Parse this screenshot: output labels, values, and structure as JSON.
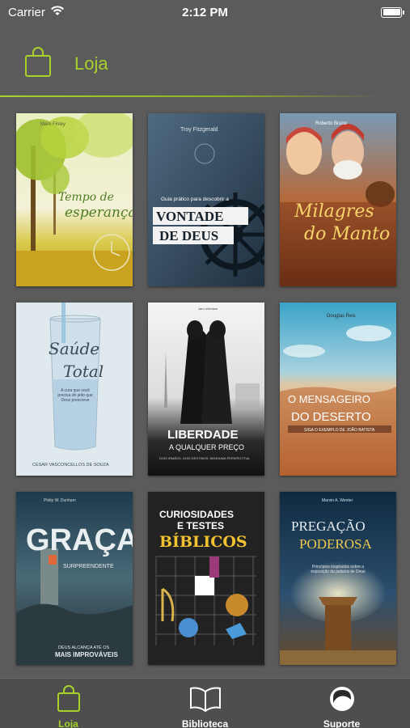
{
  "status": {
    "carrier": "Carrier",
    "time": "2:12 PM"
  },
  "header": {
    "title": "Loja"
  },
  "colors": {
    "accent": "#a8d12a",
    "background": "#5b5b5b",
    "tabbar": "#4e4e4e"
  },
  "books": [
    {
      "author": "Mark Finley",
      "title_line1": "Tempo de",
      "title_line2": "esperança"
    },
    {
      "author": "Troy Fitzgerald",
      "subtitle": "Guia prático para descobrir a",
      "title_line1": "VONTADE",
      "title_line2": "DE DEUS"
    },
    {
      "author": "Roberto Bruno",
      "title_line1": "Milagres",
      "title_line2": "do Manto"
    },
    {
      "title_line1": "Saúde",
      "title_line2": "Total",
      "tagline": "A cura que você precisa do jeito que Deus prescreve",
      "author": "CESAR VASCONCELLOS DE SOUZA"
    },
    {
      "author": "Jan Lehmann",
      "title_line1": "LIBERDADE",
      "title_line2": "A QUALQUER PREÇO",
      "tagline": "DOIS IRMÃOS. DOIS DESTINOS. NENHUMA PERSPECTIVA."
    },
    {
      "author": "Douglas Reis",
      "title_line1": "O MENSAGEIRO",
      "title_line2": "DO DESERTO",
      "tagline": "SIGA O EXEMPLO DE JOÃO BATISTA"
    },
    {
      "author": "Philip W. Dunham",
      "title_line1": "GRAÇA",
      "title_line2": "SURPREENDENTE",
      "tagline_line1": "DEUS ALCANÇA ATÉ OS",
      "tagline_line2": "MAIS IMPROVÁVEIS"
    },
    {
      "title_line1": "CURIOSIDADES",
      "title_line2": "E TESTES",
      "title_line3": "BÍBLICOS"
    },
    {
      "author": "Marvin A. Wenter",
      "title_line1": "PREGAÇÃO",
      "title_line2": "PODEROSA",
      "tagline": "Princípios inspirados sobre a exposição da palavra de Deus"
    }
  ],
  "tabs": [
    {
      "label": "Loja",
      "icon": "shopping-bag-icon",
      "active": true
    },
    {
      "label": "Biblioteca",
      "icon": "open-book-icon",
      "active": false
    },
    {
      "label": "Suporte",
      "icon": "support-headset-icon",
      "active": false
    }
  ]
}
